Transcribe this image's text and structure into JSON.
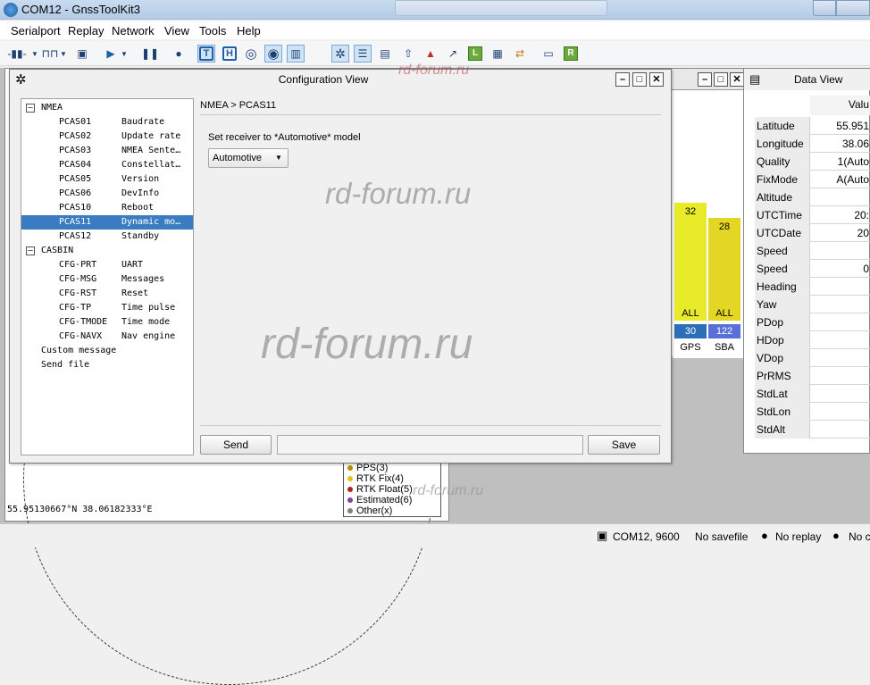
{
  "window": {
    "title": "COM12 - GnssToolKit3"
  },
  "menu": [
    "Serialport",
    "Replay",
    "Network",
    "View",
    "Tools",
    "Help"
  ],
  "toolbar": {
    "h_label": "H",
    "t_label": "T",
    "l_label": "L",
    "r_label": "R",
    "s_label": "S"
  },
  "skyplot": {
    "coordinate": "55.95130667°N 38.06182333°E"
  },
  "legend": [
    {
      "label": "PPS(3)",
      "color": "#b09000"
    },
    {
      "label": "RTK Fix(4)",
      "color": "#e8c020"
    },
    {
      "label": "RTK Float(5)",
      "color": "#b02020"
    },
    {
      "label": "Estimated(6)",
      "color": "#8040a0"
    },
    {
      "label": "Other(x)",
      "color": "#808080"
    }
  ],
  "signal": {
    "bars": [
      {
        "value": "32",
        "all": "ALL",
        "prn": "30",
        "constellation": "GPS",
        "prn_color": "#2a6fb8"
      },
      {
        "value": "28",
        "all": "ALL",
        "prn": "122",
        "constellation": "SBA",
        "prn_color": "#5a70d8"
      }
    ]
  },
  "dataview": {
    "title": "Data View",
    "value_header": "Valu",
    "rows": [
      {
        "key": "Latitude",
        "value": "55.951"
      },
      {
        "key": "Longitude",
        "value": "38.06"
      },
      {
        "key": "Quality",
        "value": "1(Auto"
      },
      {
        "key": "FixMode",
        "value": "A(Auto"
      },
      {
        "key": "Altitude",
        "value": ""
      },
      {
        "key": "UTCTime",
        "value": "20:"
      },
      {
        "key": "UTCDate",
        "value": "20"
      },
      {
        "key": "Speed",
        "value": ""
      },
      {
        "key": "Speed",
        "value": "0"
      },
      {
        "key": "Heading",
        "value": ""
      },
      {
        "key": "Yaw",
        "value": ""
      },
      {
        "key": "PDop",
        "value": ""
      },
      {
        "key": "HDop",
        "value": ""
      },
      {
        "key": "VDop",
        "value": ""
      },
      {
        "key": "PrRMS",
        "value": ""
      },
      {
        "key": "StdLat",
        "value": ""
      },
      {
        "key": "StdLon",
        "value": ""
      },
      {
        "key": "StdAlt",
        "value": ""
      }
    ]
  },
  "config": {
    "title": "Configuration View",
    "breadcrumb": "NMEA > PCAS11",
    "description": "Set receiver to *Automotive* model",
    "select_value": "Automotive",
    "send_label": "Send",
    "save_label": "Save",
    "command_value": "",
    "tree": [
      {
        "kind": "group",
        "label": "NMEA",
        "expander": "⊟"
      },
      {
        "kind": "item",
        "cmd": "PCAS01",
        "desc": "Baudrate"
      },
      {
        "kind": "item",
        "cmd": "PCAS02",
        "desc": "Update rate"
      },
      {
        "kind": "item",
        "cmd": "PCAS03",
        "desc": "NMEA Sente…"
      },
      {
        "kind": "item",
        "cmd": "PCAS04",
        "desc": "Constellat…"
      },
      {
        "kind": "item",
        "cmd": "PCAS05",
        "desc": "Version"
      },
      {
        "kind": "item",
        "cmd": "PCAS06",
        "desc": "DevInfo"
      },
      {
        "kind": "item",
        "cmd": "PCAS10",
        "desc": "Reboot"
      },
      {
        "kind": "item",
        "cmd": "PCAS11",
        "desc": "Dynamic mo…",
        "selected": true
      },
      {
        "kind": "item",
        "cmd": "PCAS12",
        "desc": "Standby"
      },
      {
        "kind": "group",
        "label": "CASBIN",
        "expander": "⊟"
      },
      {
        "kind": "item",
        "cmd": "CFG-PRT",
        "desc": "UART"
      },
      {
        "kind": "item",
        "cmd": "CFG-MSG",
        "desc": "Messages"
      },
      {
        "kind": "item",
        "cmd": "CFG-RST",
        "desc": "Reset"
      },
      {
        "kind": "item",
        "cmd": "CFG-TP",
        "desc": "Time pulse"
      },
      {
        "kind": "item",
        "cmd": "CFG-TMODE",
        "desc": "Time mode"
      },
      {
        "kind": "item",
        "cmd": "CFG-NAVX",
        "desc": "Nav engine"
      },
      {
        "kind": "root",
        "label": "Custom message"
      },
      {
        "kind": "root",
        "label": "Send file"
      }
    ]
  },
  "statusbar": {
    "port": "COM12, 9600",
    "savefile": "No savefile",
    "replay": "No replay",
    "other": "No c"
  },
  "watermark": "rd-forum.ru"
}
